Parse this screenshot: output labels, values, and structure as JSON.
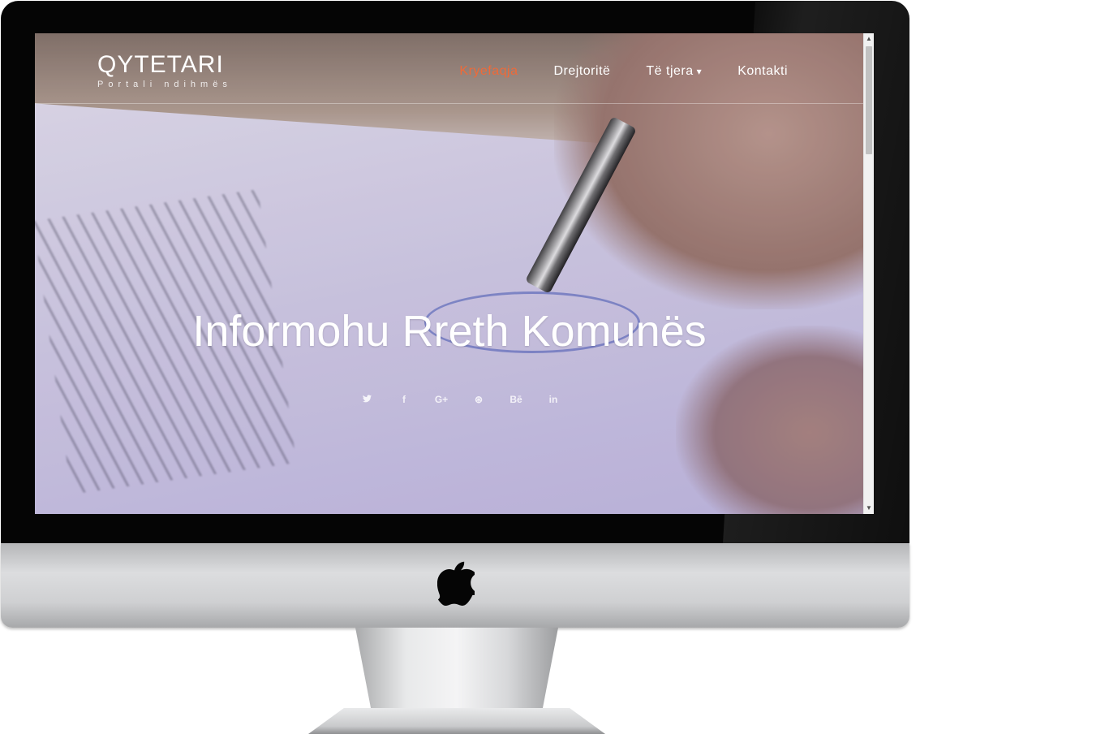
{
  "brand": {
    "title": "QYTETARI",
    "subtitle": "Portali ndihmës"
  },
  "nav": {
    "items": [
      {
        "label": "Kryefaqja",
        "active": true
      },
      {
        "label": "Drejtoritë",
        "active": false
      },
      {
        "label": "Të tjera",
        "active": false,
        "has_dropdown": true
      },
      {
        "label": "Kontakti",
        "active": false
      }
    ],
    "dropdown_caret": "▾"
  },
  "hero": {
    "headline": "Informohu Rreth Komunës"
  },
  "social": [
    {
      "icon": "twitter-icon",
      "glyph": "🐦"
    },
    {
      "icon": "facebook-icon",
      "glyph": "f"
    },
    {
      "icon": "google-plus-icon",
      "glyph": "G+"
    },
    {
      "icon": "dribbble-icon",
      "glyph": "⊛"
    },
    {
      "icon": "behance-icon",
      "glyph": "Bē"
    },
    {
      "icon": "linkedin-icon",
      "glyph": "in"
    }
  ],
  "colors": {
    "accent": "#ef6a38",
    "nav_text": "#ffffff"
  }
}
